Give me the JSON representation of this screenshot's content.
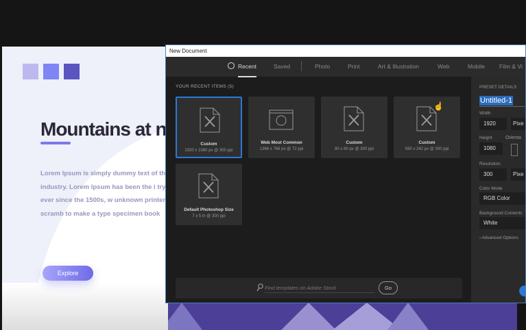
{
  "design": {
    "title": "Mountains at nig",
    "body": "Lorem Ipsum is simply dummy text of the printing typesetting industry. Lorem Ipsum has been the i try's standard dummy text ever since the 1500s, w unknown printer took a galley of type and scramb to make a type specimen book",
    "explore_label": "Explore",
    "swatches": [
      "#bdb9f0",
      "#7f85f2",
      "#5a55bf"
    ]
  },
  "dialog": {
    "title": "New Document",
    "tabs": [
      {
        "label": "Recent",
        "active": true
      },
      {
        "label": "Saved"
      },
      {
        "label": "Photo"
      },
      {
        "label": "Print"
      },
      {
        "label": "Art & Illustration"
      },
      {
        "label": "Web"
      },
      {
        "label": "Mobile"
      },
      {
        "label": "Film & Vi"
      }
    ],
    "recent_heading": "YOUR RECENT ITEMS  (5)",
    "items": [
      {
        "name": "Custom",
        "size": "1920 x 1080 px @ 300 ppi",
        "icon": "document-icon",
        "selected": true
      },
      {
        "name": "Web Most Common",
        "size": "1366 x 768 px @ 72 ppi",
        "icon": "web-globe-icon"
      },
      {
        "name": "Custom",
        "size": "80 x 80 px @ 300 ppi",
        "icon": "document-icon"
      },
      {
        "name": "Custom",
        "size": "590 x 242 px @ 300 ppi",
        "icon": "document-icon"
      },
      {
        "name": "Default Photoshop Size",
        "size": "7 x 5 in @ 300 ppi",
        "icon": "document-icon"
      }
    ],
    "search_placeholder": "Find templates on Adobe Stock",
    "go_label": "Go",
    "preset": {
      "heading": "PRESET DETAILS",
      "name": "Untitled-1",
      "width_label": "Width",
      "width": "1920",
      "width_unit": "Pixe",
      "height_label": "Height",
      "height": "1080",
      "orientation_label": "Orienta",
      "resolution_label": "Resolution",
      "resolution": "300",
      "resolution_unit": "Pixe",
      "color_mode_label": "Color Mode",
      "color_mode": "RGB Color",
      "background_label": "Background Contents",
      "background": "White",
      "advanced": "Advanced Options"
    }
  }
}
